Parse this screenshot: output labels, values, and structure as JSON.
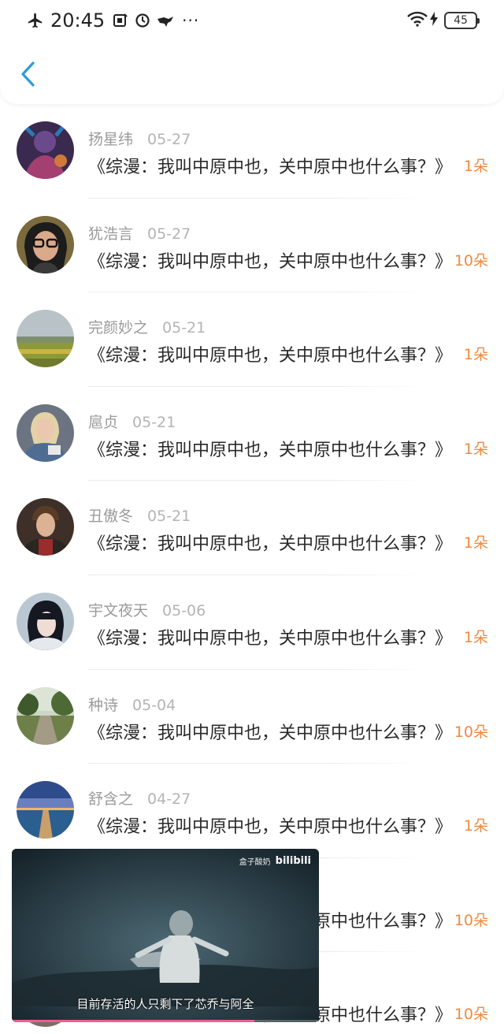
{
  "status_bar": {
    "time": "20:45",
    "battery": "45",
    "icons": [
      "airplane-icon",
      "sim-icon",
      "sync-icon",
      "bird-icon",
      "more-icon",
      "wifi-icon",
      "charging-icon",
      "battery-icon"
    ],
    "more": "···"
  },
  "header": {
    "back_icon": "chevron-left-icon",
    "accent_color": "#2f9bd8"
  },
  "list": [
    {
      "name": "扬星纬",
      "date": "05-27",
      "title": "《综漫：我叫中原中也，关中原中也什么事？》",
      "count": "1朵",
      "avatar": "avatar-1"
    },
    {
      "name": "犹浩言",
      "date": "05-27",
      "title": "《综漫：我叫中原中也，关中原中也什么事？》",
      "count": "10朵",
      "avatar": "avatar-2"
    },
    {
      "name": "完颜妙之",
      "date": "05-21",
      "title": "《综漫：我叫中原中也，关中原中也什么事？》",
      "count": "1朵",
      "avatar": "avatar-3"
    },
    {
      "name": "扈贞",
      "date": "05-21",
      "title": "《综漫：我叫中原中也，关中原中也什么事？》",
      "count": "1朵",
      "avatar": "avatar-4"
    },
    {
      "name": "丑傲冬",
      "date": "05-21",
      "title": "《综漫：我叫中原中也，关中原中也什么事？》",
      "count": "1朵",
      "avatar": "avatar-5"
    },
    {
      "name": "宇文夜天",
      "date": "05-06",
      "title": "《综漫：我叫中原中也，关中原中也什么事？》",
      "count": "1朵",
      "avatar": "avatar-6"
    },
    {
      "name": "种诗",
      "date": "05-04",
      "title": "《综漫：我叫中原中也，关中原中也什么事？》",
      "count": "10朵",
      "avatar": "avatar-7"
    },
    {
      "name": "舒含之",
      "date": "04-27",
      "title": "《综漫：我叫中原中也，关中原中也什么事？》",
      "count": "1朵",
      "avatar": "avatar-8"
    },
    {
      "name": "",
      "date": "",
      "title": "《综漫：我叫中原中也，关中原中也什么事？》",
      "count": "10朵",
      "avatar": "avatar-9"
    },
    {
      "name": "",
      "date": "",
      "title": "《综漫：我叫中原中也，关中原中也什么事？》",
      "count": "10朵",
      "avatar": "avatar-10"
    }
  ],
  "video": {
    "brand_small": "盒子酸奶",
    "brand_logo": "bilibili",
    "subtitle": "目前存活的人只剩下了芯乔与阿全",
    "progress": 0.79,
    "progress_color": "#f25d8e"
  },
  "colors": {
    "count": "#f08a3e",
    "name": "#9a9a9a",
    "title": "#2a2a2a"
  }
}
